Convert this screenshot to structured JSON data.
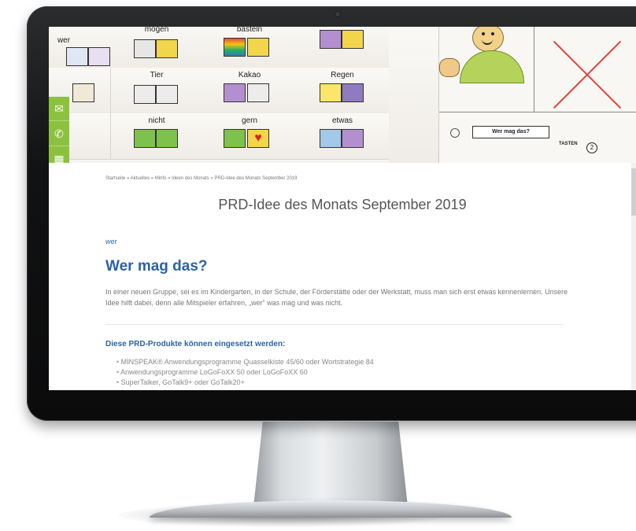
{
  "banner": {
    "cards": [
      {
        "word": "wer"
      },
      {
        "word": "mögen"
      },
      {
        "word": "basteln"
      },
      {
        "word": ""
      },
      {
        "word": "Tier"
      },
      {
        "word": "Kakao"
      },
      {
        "word": "Regen"
      },
      {
        "word": "nicht"
      },
      {
        "word": "gern"
      },
      {
        "word": "etwas"
      }
    ],
    "sheet_label": "Wer mag das?",
    "sheet_tasten": "TASTEN",
    "sheet_number": "2"
  },
  "contact_strip": {
    "icons": [
      "mail-icon",
      "phone-icon",
      "map-icon"
    ]
  },
  "breadcrumb": "Startseite » Aktuelles » Minfo » Ideen des Monats » PRD-Idee des Monats September 2019",
  "page_title": "PRD-Idee des Monats September 2019",
  "eyebrow": "wer",
  "section_title": "Wer mag das?",
  "intro_text": "In einer neuen Gruppe, sei es im Kindergarten, in der Schule, der Förderstätte oder der Werkstatt, muss man sich erst etwas kennenlernen. Unsere Idee hilft dabei, denn alle Mitspieler erfahren, „wer“ was mag und was nicht.",
  "products_heading": "Diese PRD-Produkte können eingesetzt werden:",
  "products": [
    "MINSPEAK® Anwendungsprogramme Quasselkiste 45/60 oder Wortstrategie 84",
    "Anwendungsprogramme LoGoFoXX 50 oder LoGoFoXX 60",
    "SuperTalker, GoTalk9+ oder GoTalk20+"
  ],
  "colors": {
    "accent_blue": "#2a62a8",
    "contact_green": "#8cc13f",
    "cross_red": "#e0413a"
  }
}
